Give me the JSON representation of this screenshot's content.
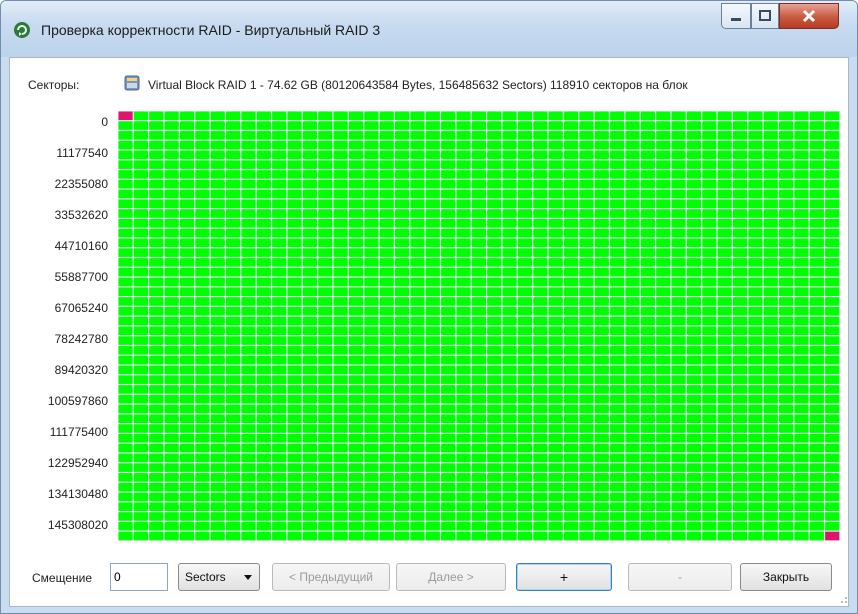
{
  "window": {
    "title": "Проверка корректности RAID - Виртуальный RAID 3"
  },
  "titlebar_buttons": {
    "minimize": "minimize",
    "maximize": "maximize",
    "close": "close"
  },
  "sectors": {
    "label": "Секторы:",
    "disk_icon": "disk-icon",
    "info": "Virtual Block RAID 1 - 74.62 GB (80120643584 Bytes, 156485632 Sectors) 118910 секторов на блок"
  },
  "grid": {
    "row_labels": [
      "0",
      "11177540",
      "22355080",
      "33532620",
      "44710160",
      "55887700",
      "67065240",
      "78242780",
      "89420320",
      "100597860",
      "111775400",
      "122952940",
      "134130480",
      "145308020"
    ],
    "columns": 47,
    "rows": 44,
    "ok_color": "#00ff00",
    "bad_color": "#e0146e",
    "bad_blocks": [
      [
        0,
        0
      ],
      [
        43,
        46
      ]
    ]
  },
  "footer": {
    "offset_label": "Смещение",
    "offset_value": "0",
    "unit": "Sectors",
    "prev": "< Предыдущий",
    "next": "Далее >",
    "plus": "+",
    "minus": "-",
    "close": "Закрыть"
  }
}
